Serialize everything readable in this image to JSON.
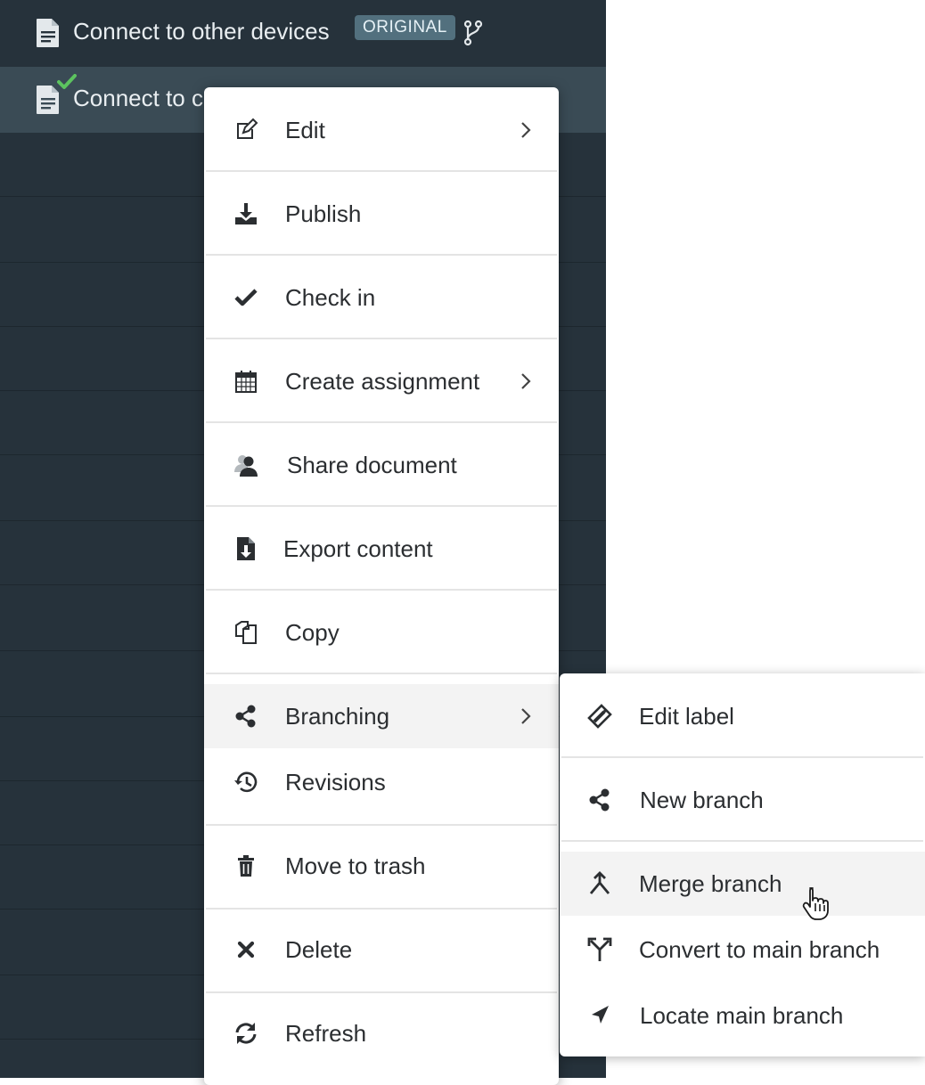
{
  "rows": [
    {
      "title": "Connect to other devices",
      "badge": "ORIGINAL",
      "icon": "document-icon",
      "extra_icon": "branch-icon"
    },
    {
      "title": "Connect to c",
      "icon": "document-icon",
      "status_icon": "check-icon"
    }
  ],
  "context_menu": {
    "items": [
      {
        "label": "Edit",
        "icon": "edit-icon",
        "submenu": true
      },
      {
        "label": "Publish",
        "icon": "publish-icon"
      },
      {
        "label": "Check in",
        "icon": "check-icon"
      },
      {
        "label": "Create assignment",
        "icon": "calendar-icon",
        "submenu": true
      },
      {
        "label": "Share document",
        "icon": "users-icon"
      },
      {
        "label": "Export content",
        "icon": "export-icon"
      },
      {
        "label": "Copy",
        "icon": "copy-icon"
      },
      {
        "label": "Branching",
        "icon": "share-icon",
        "submenu": true,
        "highlighted": true
      },
      {
        "label": "Revisions",
        "icon": "history-icon"
      },
      {
        "label": "Move to trash",
        "icon": "trash-icon"
      },
      {
        "label": "Delete",
        "icon": "close-icon"
      },
      {
        "label": "Refresh",
        "icon": "refresh-icon"
      }
    ]
  },
  "submenu": {
    "items": [
      {
        "label": "Edit label",
        "icon": "label-icon"
      },
      {
        "label": "New branch",
        "icon": "share-icon"
      },
      {
        "label": "Merge branch",
        "icon": "merge-icon",
        "highlighted": true
      },
      {
        "label": "Convert to main branch",
        "icon": "convert-icon"
      },
      {
        "label": "Locate main branch",
        "icon": "locate-icon"
      }
    ]
  },
  "colors": {
    "sidebar_bg": "#26323b",
    "selected_row_bg": "#3a4b55",
    "badge_bg": "#52707e",
    "check_green": "#5cc35f",
    "menu_text": "#2b2e31",
    "highlight_bg": "#f3f3f3"
  }
}
